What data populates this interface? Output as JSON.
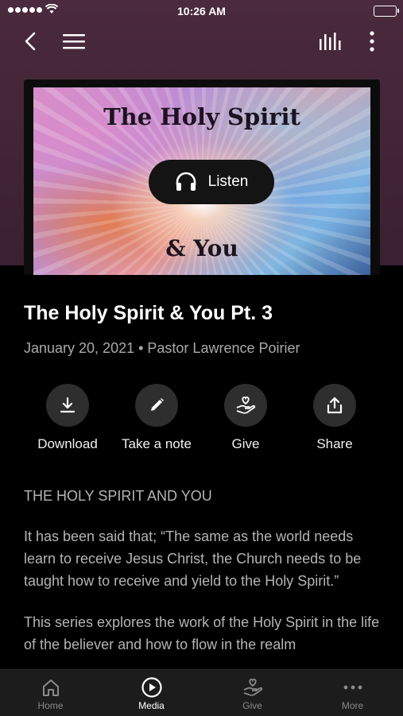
{
  "status_bar": {
    "time": "10:26 AM"
  },
  "nav": {
    "back_icon": "chevron-left-icon",
    "menu_icon": "hamburger-icon",
    "audio_icon": "bars-icon",
    "more_icon": "kebab-icon"
  },
  "artwork": {
    "title_line1": "The Holy Spirit",
    "title_line2": "& You",
    "listen_label": "Listen"
  },
  "media": {
    "title": "The Holy Spirit & You Pt. 3",
    "meta": "January 20, 2021 • Pastor Lawrence Poirier"
  },
  "actions": [
    {
      "label": "Download",
      "icon": "download-icon"
    },
    {
      "label": "Take a note",
      "icon": "pencil-icon"
    },
    {
      "label": "Give",
      "icon": "hand-heart-icon"
    },
    {
      "label": "Share",
      "icon": "share-icon"
    }
  ],
  "description": {
    "heading": "THE HOLY SPIRIT AND YOU",
    "paragraph1": "It has been said that; “The same as the world needs learn to receive Jesus Christ, the Church needs to be taught how to receive and yield to the Holy Spirit.”",
    "paragraph2": "This series explores the work of the Holy Spirit in the life of the believer and how to flow in the realm"
  },
  "tabs": [
    {
      "label": "Home",
      "icon": "home-icon"
    },
    {
      "label": "Media",
      "icon": "play-circle-icon"
    },
    {
      "label": "Give",
      "icon": "hand-heart-icon"
    },
    {
      "label": "More",
      "icon": "more-dots-icon"
    }
  ],
  "colors": {
    "header_bg": "#4a2a3c",
    "background": "#000000",
    "tab_bar": "#1c1c1c"
  }
}
